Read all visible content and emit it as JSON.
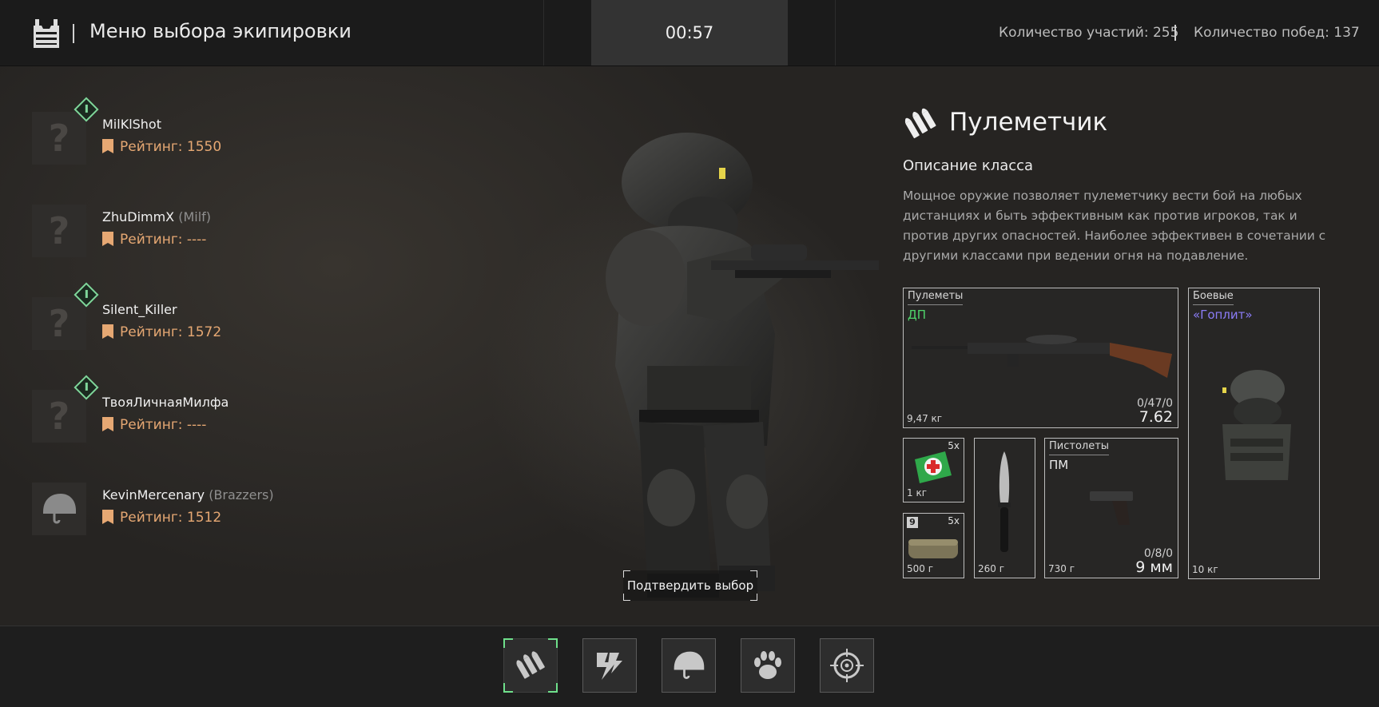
{
  "header": {
    "title": "Меню выбора экипировки",
    "timer": "00:57",
    "participations": "Количество участий: 255",
    "wins": "Количество побед: 137"
  },
  "players": [
    {
      "name": "MilKlShot",
      "clan": "",
      "rating": "Рейтинг: 1550",
      "avatar": "?",
      "badge": true
    },
    {
      "name": "ZhuDimmX",
      "clan": "(Milf)",
      "rating": "Рейтинг: ----",
      "avatar": "?",
      "badge": false
    },
    {
      "name": "Silent_Killer",
      "clan": "",
      "rating": "Рейтинг: 1572",
      "avatar": "?",
      "badge": true
    },
    {
      "name": "ТвояЛичнаяМилфа",
      "clan": "",
      "rating": "Рейтинг: ----",
      "avatar": "?",
      "badge": true
    },
    {
      "name": "KevinMercenary",
      "clan": "(Brazzers)",
      "rating": "Рейтинг: 1512",
      "avatar": "helmet-icon",
      "badge": false
    }
  ],
  "confirm_label": "Подтвердить выбор",
  "class_info": {
    "title": "Пулеметчик",
    "desc_heading": "Описание класса",
    "description": "Мощное оружие позволяет пулеметчику вести бой на любых дистанциях и быть эффективным как против игроков, так и против других опасностей. Наиболее эффективен в сочетании с другими классами при ведении огня на подавление."
  },
  "loadout": {
    "primary": {
      "category": "Пулеметы",
      "name": "ДП",
      "name_color": "#4fd36a",
      "weight": "9,47 кг",
      "ammo": "0/47/0",
      "caliber": "7.62"
    },
    "armor": {
      "category": "Боевые",
      "name": "«Гоплит»",
      "name_color": "#8b7cf6",
      "weight": "10 кг"
    },
    "medkit": {
      "qty": "5x",
      "weight": "1 кг"
    },
    "bandage": {
      "level": "9",
      "qty": "5x",
      "weight": "500 г"
    },
    "knife": {
      "weight": "260 г"
    },
    "pistol": {
      "category": "Пистолеты",
      "name": "ПМ",
      "name_color": "#e8e8e8",
      "weight": "730 г",
      "ammo": "0/8/0",
      "caliber": "9 мм"
    }
  },
  "class_buttons": [
    "ammo-icon",
    "lightning-icon",
    "helmet-icon",
    "paw-icon",
    "crosshair-icon"
  ],
  "colors": {
    "rating": "#e6a873",
    "badge": "#7fd69a",
    "selection": "#6fe08b"
  }
}
